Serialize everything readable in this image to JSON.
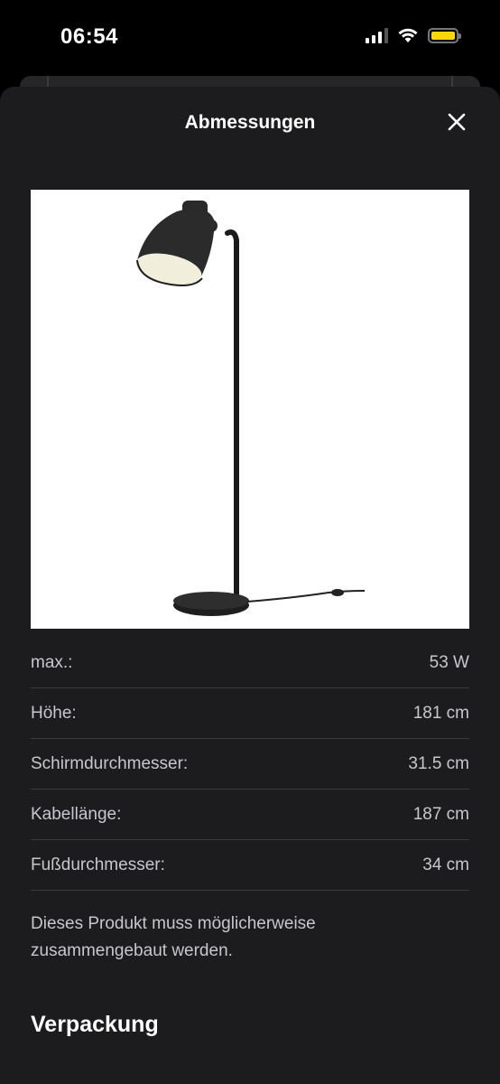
{
  "status_bar": {
    "time": "06:54",
    "icons": [
      "cellular-signal-icon",
      "wifi-icon",
      "battery-icon"
    ],
    "battery_color": "#ffd60a"
  },
  "sheet": {
    "title": "Abmessungen",
    "close_icon": "close-icon",
    "background": "#1c1c1e"
  },
  "product_image": {
    "subject": "floor-lamp"
  },
  "specs": [
    {
      "label": "max.:",
      "value": "53 W"
    },
    {
      "label": "Höhe:",
      "value": "181 cm"
    },
    {
      "label": "Schirmdurchmesser:",
      "value": "31.5 cm"
    },
    {
      "label": "Kabellänge:",
      "value": "187 cm"
    },
    {
      "label": "Fußdurchmesser:",
      "value": "34 cm"
    }
  ],
  "assembly_note": "Dieses Produkt muss möglicherweise zusammengebaut werden.",
  "section_heading": "Verpackung"
}
